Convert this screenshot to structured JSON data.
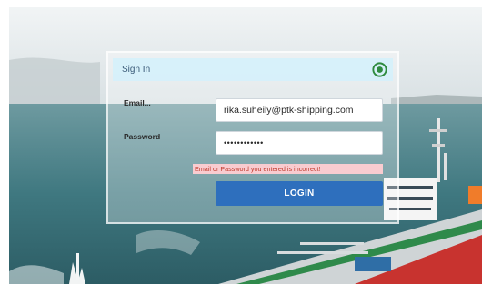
{
  "login": {
    "title": "Sign In",
    "email_label": "Email...",
    "email_value": "rika.suheily@ptk-shipping.com",
    "password_label": "Password",
    "password_value": "••••••••••••",
    "error_message": "Email or Password you entered is incorrect!",
    "login_button": "LOGIN"
  },
  "icons": {
    "status": "ok-circle-icon"
  },
  "colors": {
    "header": "#d6f0fa",
    "button": "#2e6fbd",
    "error_bg": "#ffcdd2",
    "error_text": "#c0392b",
    "icon": "#2e8b3e"
  }
}
